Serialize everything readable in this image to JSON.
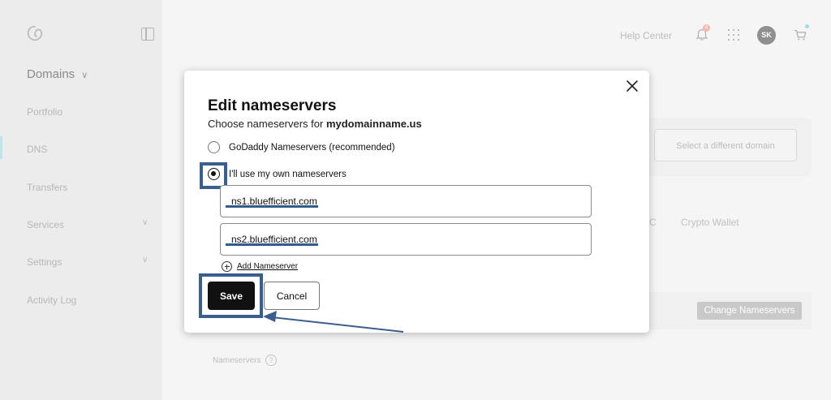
{
  "app": {
    "nav_heading": "Domains",
    "nav_items": [
      {
        "label": "Portfolio"
      },
      {
        "label": "DNS"
      },
      {
        "label": "Transfers"
      },
      {
        "label": "Services"
      },
      {
        "label": "Settings"
      },
      {
        "label": "Activity Log"
      }
    ],
    "header": {
      "help_center": "Help Center",
      "notification_count": "4",
      "avatar_initials": "SK"
    },
    "background": {
      "select_domain_button": "Select a different domain",
      "tab_partial": "C",
      "tab_crypto": "Crypto Wallet",
      "change_nameservers_button": "Change Nameservers",
      "nameservers_label": "Nameservers",
      "help_glyph": "?"
    }
  },
  "modal": {
    "title": "Edit nameservers",
    "subtitle_prefix": "Choose nameservers for ",
    "domain": "mydomainname.us",
    "options": [
      {
        "label": "GoDaddy Nameservers (recommended)",
        "selected": false
      },
      {
        "label": "I'll use my own nameservers",
        "selected": true
      }
    ],
    "nameservers": [
      {
        "value": "ns1.bluefficient.com"
      },
      {
        "value": "ns2.bluefficient.com"
      }
    ],
    "add_nameserver": "Add Nameserver",
    "save_label": "Save",
    "cancel_label": "Cancel"
  },
  "colors": {
    "annotation_blue": "#3a5f8f",
    "primary_button": "#111111",
    "accent_teal": "#bfe4ea"
  }
}
